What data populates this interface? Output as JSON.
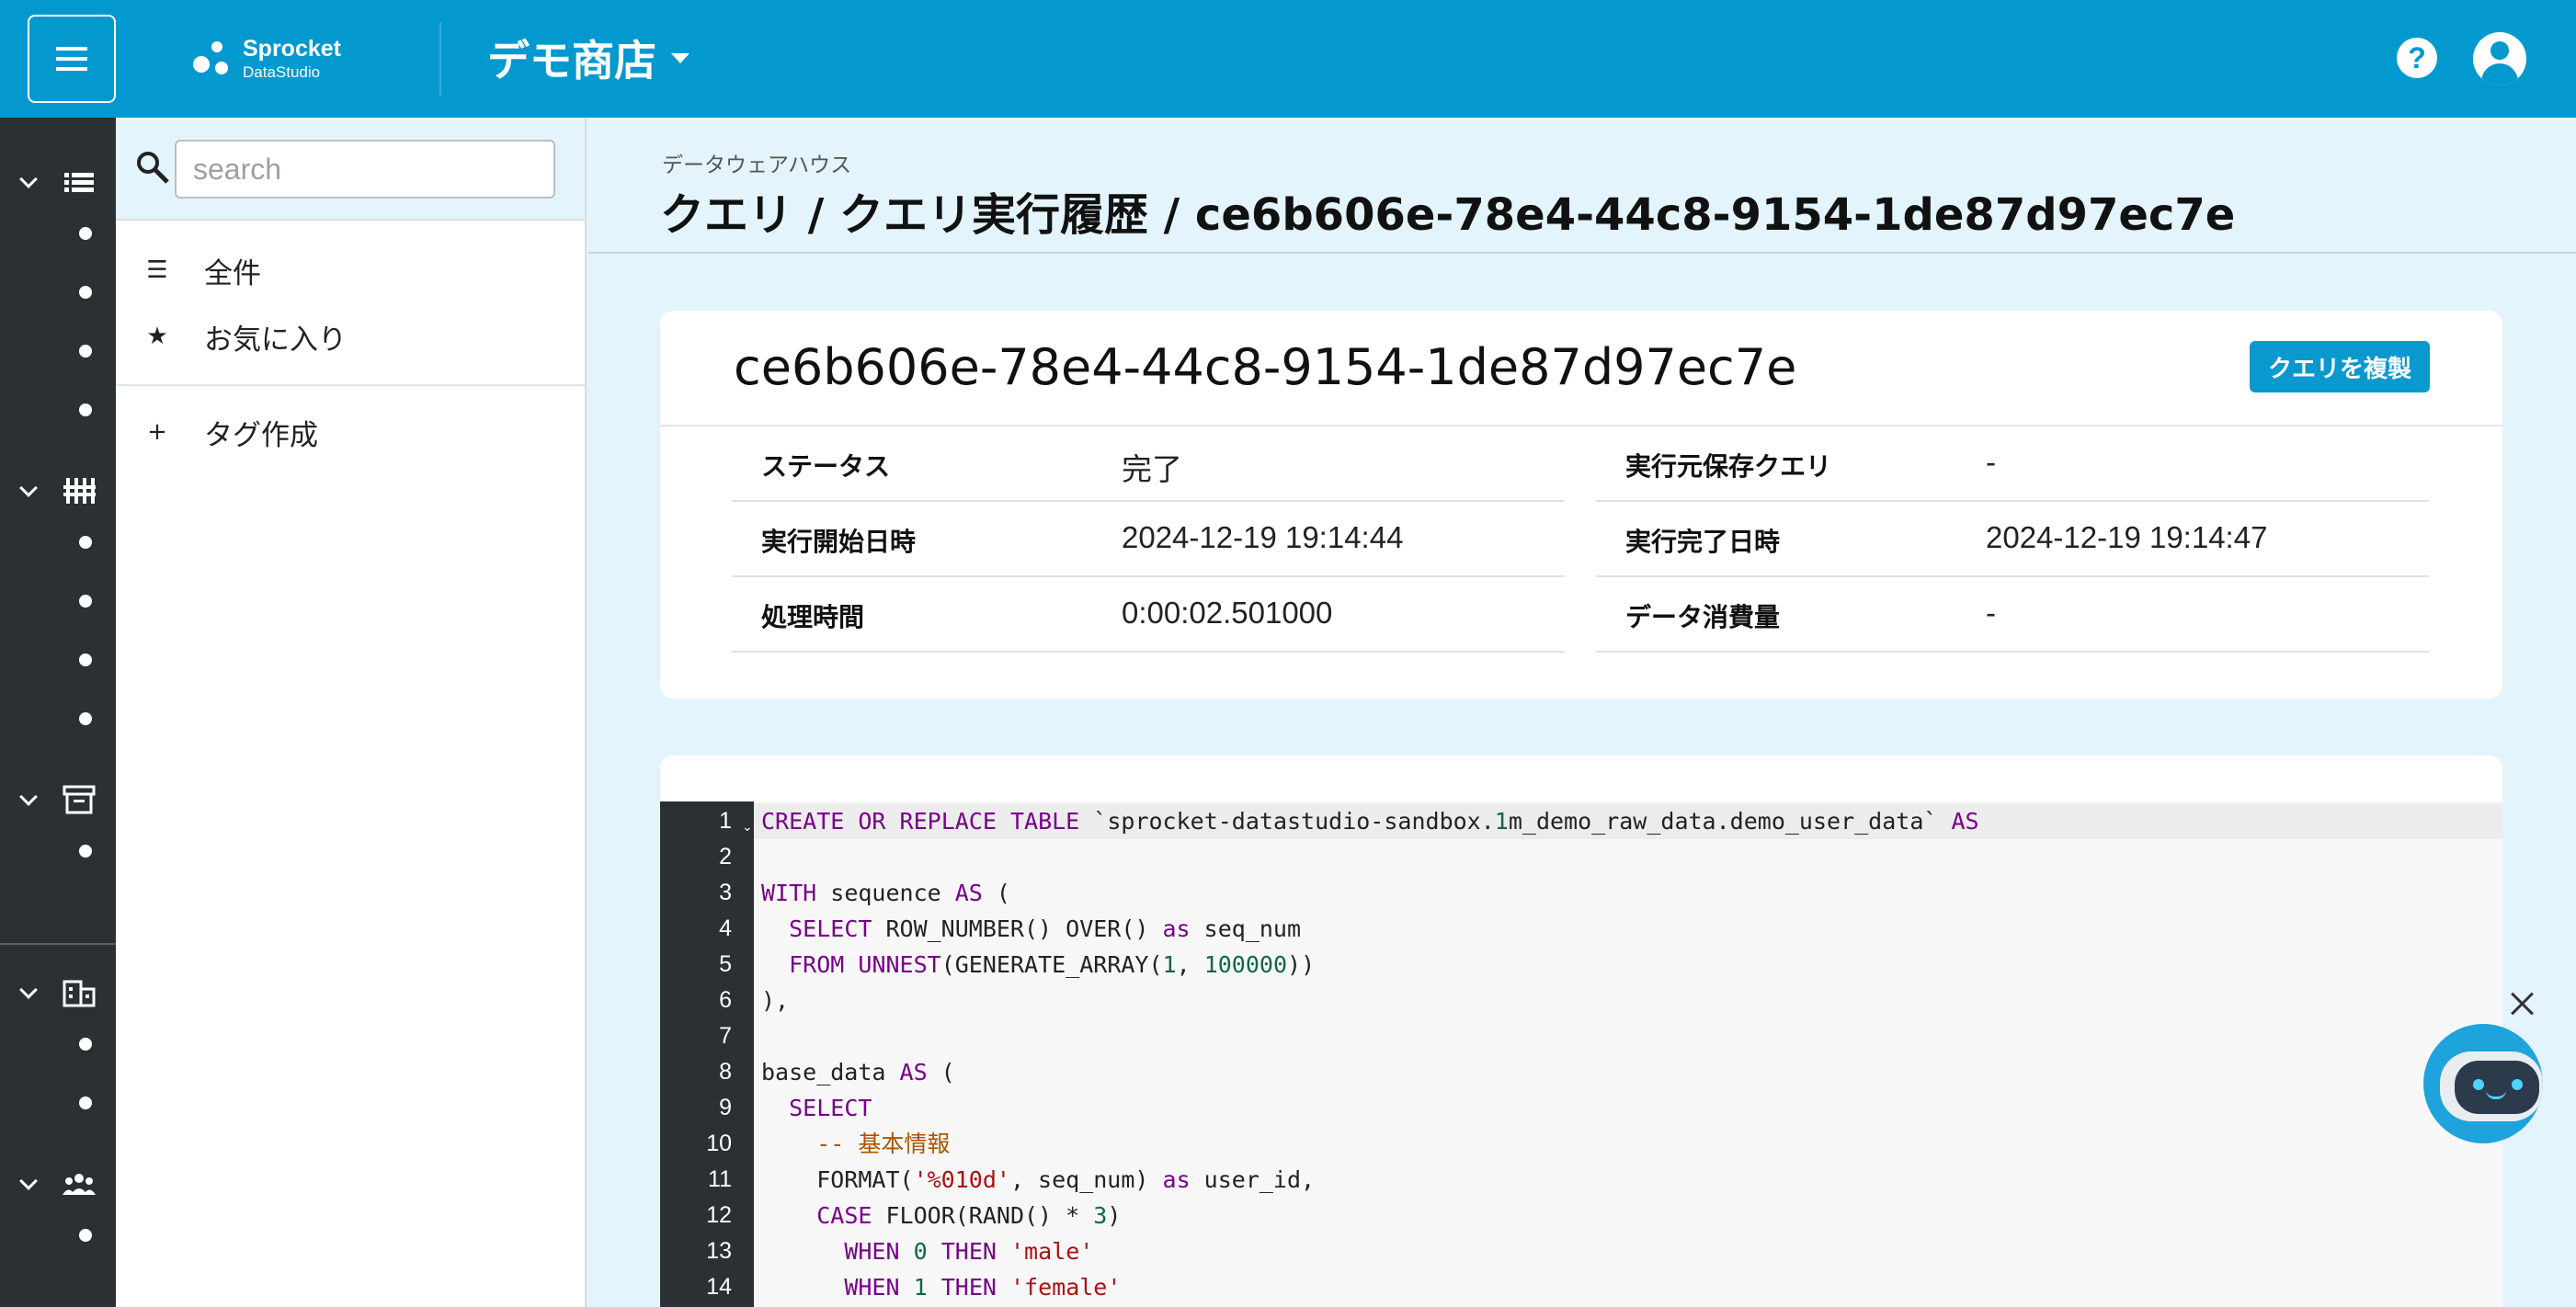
{
  "header": {
    "menu_icon": "hamburger-icon",
    "logo_name": "Sprocket",
    "logo_sub": "DataStudio",
    "shop_name": "デモ商店",
    "help_icon": "help-icon",
    "help_glyph": "?",
    "account_icon": "account-icon",
    "brand_color": "#0399cf"
  },
  "rail": {
    "groups": [
      {
        "icon": "list-icon",
        "dots": 4
      },
      {
        "icon": "pipeline-icon",
        "dots": 4
      },
      {
        "icon": "archive-icon",
        "dots": 1
      },
      {
        "icon": "building-icon",
        "dots": 2
      },
      {
        "icon": "users-icon",
        "dots": 1
      }
    ]
  },
  "sidebar": {
    "search_placeholder": "search",
    "items": [
      {
        "icon": "list-icon",
        "glyph": "☰",
        "label": "全件"
      },
      {
        "icon": "star-icon",
        "glyph": "★",
        "label": "お気に入り"
      },
      {
        "icon": "plus-icon",
        "glyph": "+",
        "label": "タグ作成"
      }
    ]
  },
  "page": {
    "section": "データウェアハウス",
    "title": "クエリ / クエリ実行履歴 / ce6b606e-78e4-44c8-9154-1de87d97ec7e"
  },
  "detail": {
    "id": "ce6b606e-78e4-44c8-9154-1de87d97ec7e",
    "duplicate_button": "クエリを複製",
    "fields_left": [
      {
        "key": "ステータス",
        "value": "完了"
      },
      {
        "key": "実行開始日時",
        "value": "2024-12-19 19:14:44"
      },
      {
        "key": "処理時間",
        "value": "0:00:02.501000"
      }
    ],
    "fields_right": [
      {
        "key": "実行元保存クエリ",
        "value": "-"
      },
      {
        "key": "実行完了日時",
        "value": "2024-12-19 19:14:47"
      },
      {
        "key": "データ消費量",
        "value": "-"
      }
    ]
  },
  "code": {
    "line_numbers": [
      "1",
      "2",
      "3",
      "4",
      "5",
      "6",
      "7",
      "8",
      "9",
      "10",
      "11",
      "12",
      "13",
      "14"
    ],
    "lines": [
      "CREATE OR REPLACE TABLE `sprocket-datastudio-sandbox.1m_demo_raw_data.demo_user_data` AS",
      "",
      "WITH sequence AS (",
      "  SELECT ROW_NUMBER() OVER() as seq_num",
      "  FROM UNNEST(GENERATE_ARRAY(1, 100000))",
      "),",
      "",
      "base_data AS (",
      "  SELECT",
      "    -- 基本情報",
      "    FORMAT('%010d', seq_num) as user_id,",
      "    CASE FLOOR(RAND() * 3)",
      "      WHEN 0 THEN 'male'",
      "      WHEN 1 THEN 'female'"
    ]
  },
  "bot": {
    "icon": "chatbot-icon",
    "close_icon": "close-icon"
  }
}
